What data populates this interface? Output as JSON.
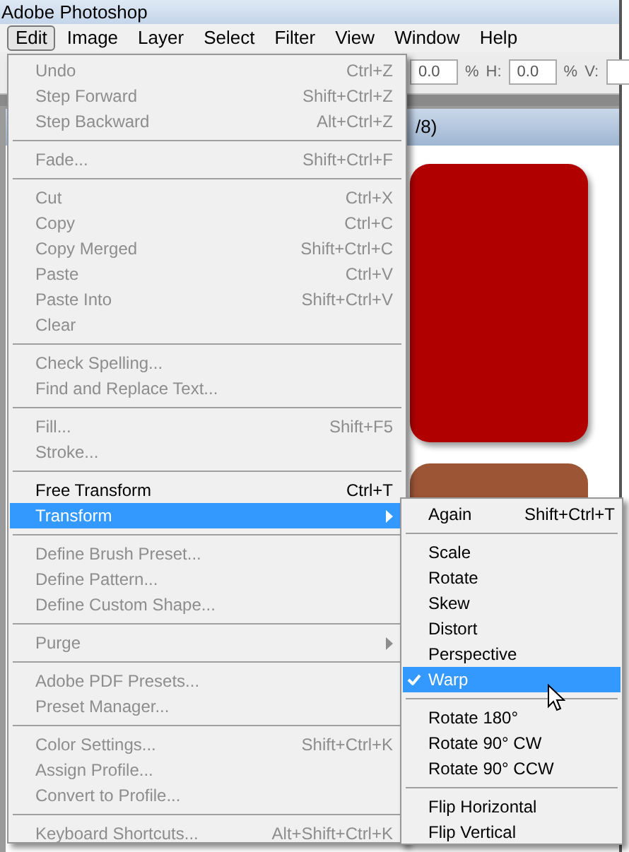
{
  "window": {
    "title": "Adobe Photoshop"
  },
  "menu_bar": [
    {
      "label": "Edit",
      "selected": true
    },
    {
      "label": "Image",
      "selected": false
    },
    {
      "label": "Layer",
      "selected": false
    },
    {
      "label": "Select",
      "selected": false
    },
    {
      "label": "Filter",
      "selected": false
    },
    {
      "label": "View",
      "selected": false
    },
    {
      "label": "Window",
      "selected": false
    },
    {
      "label": "Help",
      "selected": false
    }
  ],
  "options_bar": [
    {
      "kind": "field",
      "value": "0.0"
    },
    {
      "kind": "label",
      "text": "%"
    },
    {
      "kind": "label",
      "text": "H:"
    },
    {
      "kind": "field",
      "value": "0.0"
    },
    {
      "kind": "label",
      "text": "%"
    },
    {
      "kind": "label",
      "text": "V:"
    },
    {
      "kind": "field"
    }
  ],
  "document": {
    "title": "/8)"
  },
  "edit_menu": [
    [
      {
        "label": "Undo",
        "shortcut": "Ctrl+Z",
        "disabled": true,
        "selected": false,
        "submenu": false
      },
      {
        "label": "Step Forward",
        "shortcut": "Shift+Ctrl+Z",
        "disabled": true,
        "selected": false,
        "submenu": false
      },
      {
        "label": "Step Backward",
        "shortcut": "Alt+Ctrl+Z",
        "disabled": true,
        "selected": false,
        "submenu": false
      }
    ],
    [
      {
        "label": "Fade...",
        "shortcut": "Shift+Ctrl+F",
        "disabled": true,
        "selected": false,
        "submenu": false
      }
    ],
    [
      {
        "label": "Cut",
        "shortcut": "Ctrl+X",
        "disabled": true,
        "selected": false,
        "submenu": false
      },
      {
        "label": "Copy",
        "shortcut": "Ctrl+C",
        "disabled": true,
        "selected": false,
        "submenu": false
      },
      {
        "label": "Copy Merged",
        "shortcut": "Shift+Ctrl+C",
        "disabled": true,
        "selected": false,
        "submenu": false
      },
      {
        "label": "Paste",
        "shortcut": "Ctrl+V",
        "disabled": true,
        "selected": false,
        "submenu": false
      },
      {
        "label": "Paste Into",
        "shortcut": "Shift+Ctrl+V",
        "disabled": true,
        "selected": false,
        "submenu": false
      },
      {
        "label": "Clear",
        "disabled": true,
        "selected": false,
        "submenu": false
      }
    ],
    [
      {
        "label": "Check Spelling...",
        "disabled": true,
        "selected": false,
        "submenu": false
      },
      {
        "label": "Find and Replace Text...",
        "disabled": true,
        "selected": false,
        "submenu": false
      }
    ],
    [
      {
        "label": "Fill...",
        "shortcut": "Shift+F5",
        "disabled": true,
        "selected": false,
        "submenu": false
      },
      {
        "label": "Stroke...",
        "disabled": true,
        "selected": false,
        "submenu": false
      }
    ],
    [
      {
        "label": "Free Transform",
        "shortcut": "Ctrl+T",
        "disabled": false,
        "selected": false,
        "submenu": false
      },
      {
        "label": "Transform",
        "disabled": false,
        "selected": true,
        "submenu": true
      }
    ],
    [
      {
        "label": "Define Brush Preset...",
        "disabled": true,
        "selected": false,
        "submenu": false
      },
      {
        "label": "Define Pattern...",
        "disabled": true,
        "selected": false,
        "submenu": false
      },
      {
        "label": "Define Custom Shape...",
        "disabled": true,
        "selected": false,
        "submenu": false
      }
    ],
    [
      {
        "label": "Purge",
        "disabled": true,
        "selected": false,
        "submenu": true
      }
    ],
    [
      {
        "label": "Adobe PDF Presets...",
        "disabled": true,
        "selected": false,
        "submenu": false
      },
      {
        "label": "Preset Manager...",
        "disabled": true,
        "selected": false,
        "submenu": false
      }
    ],
    [
      {
        "label": "Color Settings...",
        "shortcut": "Shift+Ctrl+K",
        "disabled": true,
        "selected": false,
        "submenu": false
      },
      {
        "label": "Assign Profile...",
        "disabled": true,
        "selected": false,
        "submenu": false
      },
      {
        "label": "Convert to Profile...",
        "disabled": true,
        "selected": false,
        "submenu": false
      }
    ],
    [
      {
        "label": "Keyboard Shortcuts...",
        "shortcut": "Alt+Shift+Ctrl+K",
        "disabled": true,
        "selected": false,
        "submenu": false
      }
    ]
  ],
  "transform_submenu": [
    [
      {
        "label": "Again",
        "shortcut": "Shift+Ctrl+T",
        "checked": false,
        "selected": false
      }
    ],
    [
      {
        "label": "Scale",
        "checked": false,
        "selected": false
      },
      {
        "label": "Rotate",
        "checked": false,
        "selected": false
      },
      {
        "label": "Skew",
        "checked": false,
        "selected": false
      },
      {
        "label": "Distort",
        "checked": false,
        "selected": false
      },
      {
        "label": "Perspective",
        "checked": false,
        "selected": false
      },
      {
        "label": "Warp",
        "checked": true,
        "selected": true
      }
    ],
    [
      {
        "label": "Rotate 180°",
        "checked": false,
        "selected": false
      },
      {
        "label": "Rotate 90° CW",
        "checked": false,
        "selected": false
      },
      {
        "label": "Rotate 90° CCW",
        "checked": false,
        "selected": false
      }
    ],
    [
      {
        "label": "Flip Horizontal",
        "checked": false,
        "selected": false
      },
      {
        "label": "Flip Vertical",
        "checked": false,
        "selected": false
      }
    ]
  ]
}
